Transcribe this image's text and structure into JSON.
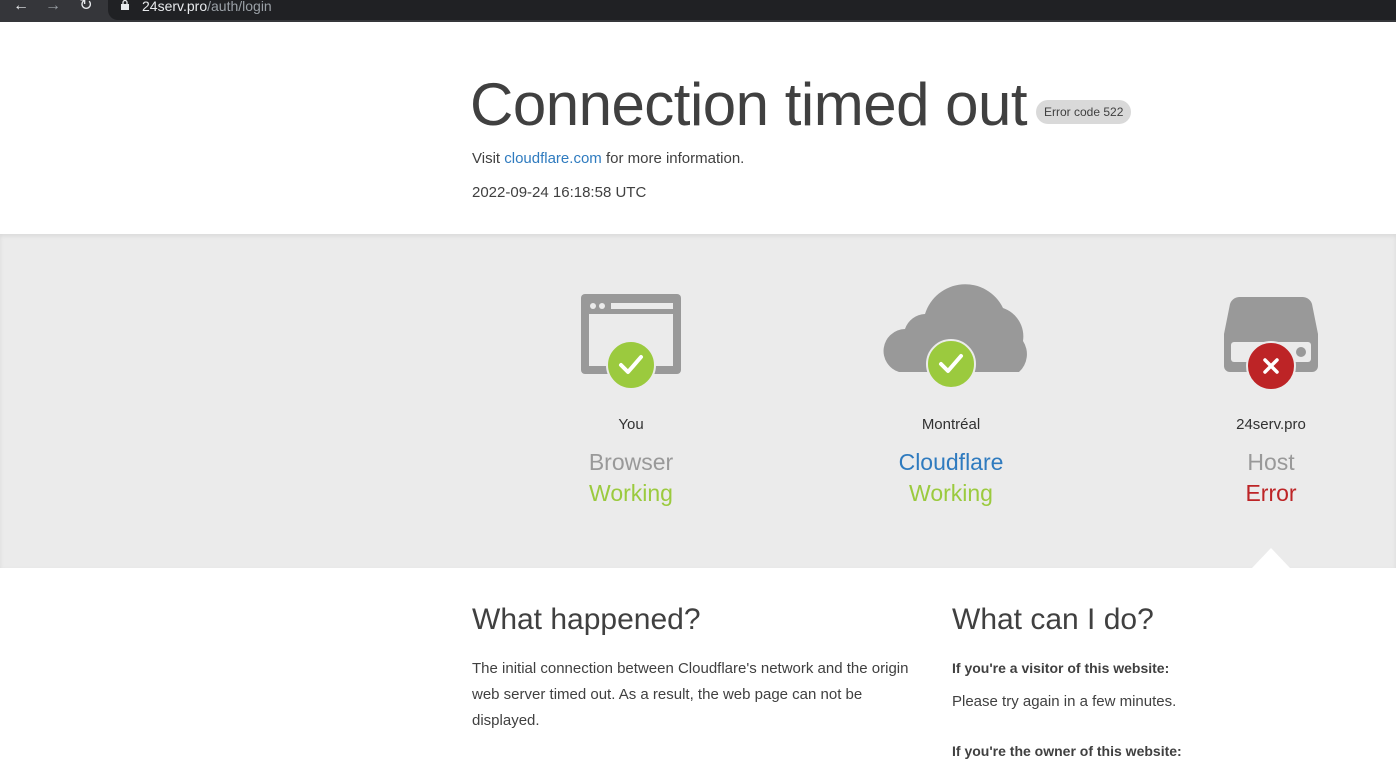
{
  "browser": {
    "url_host": "24serv.pro",
    "url_path": "/auth/login"
  },
  "header": {
    "title": "Connection timed out",
    "error_badge": "Error code 522",
    "visit_prefix": "Visit ",
    "visit_link": "cloudflare.com",
    "visit_suffix": " for more information.",
    "timestamp": "2022-09-24 16:18:58 UTC"
  },
  "status": [
    {
      "place": "You",
      "kind": "Browser",
      "state": "Working",
      "ok": true
    },
    {
      "place": "Montréal",
      "kind": "Cloudflare",
      "state": "Working",
      "ok": true
    },
    {
      "place": "24serv.pro",
      "kind": "Host",
      "state": "Error",
      "ok": false
    }
  ],
  "what_happened": {
    "heading": "What happened?",
    "text": "The initial connection between Cloudflare's network and the origin web server timed out. As a result, the web page can not be displayed."
  },
  "what_can_i_do": {
    "heading": "What can I do?",
    "visitor_heading": "If you're a visitor of this website:",
    "visitor_text": "Please try again in a few minutes.",
    "owner_heading": "If you're the owner of this website:"
  },
  "colors": {
    "ok": "#9bca3e",
    "error": "#bd2426",
    "link": "#2f7bbf",
    "band": "#ebebeb",
    "icon_gray": "#999999"
  }
}
